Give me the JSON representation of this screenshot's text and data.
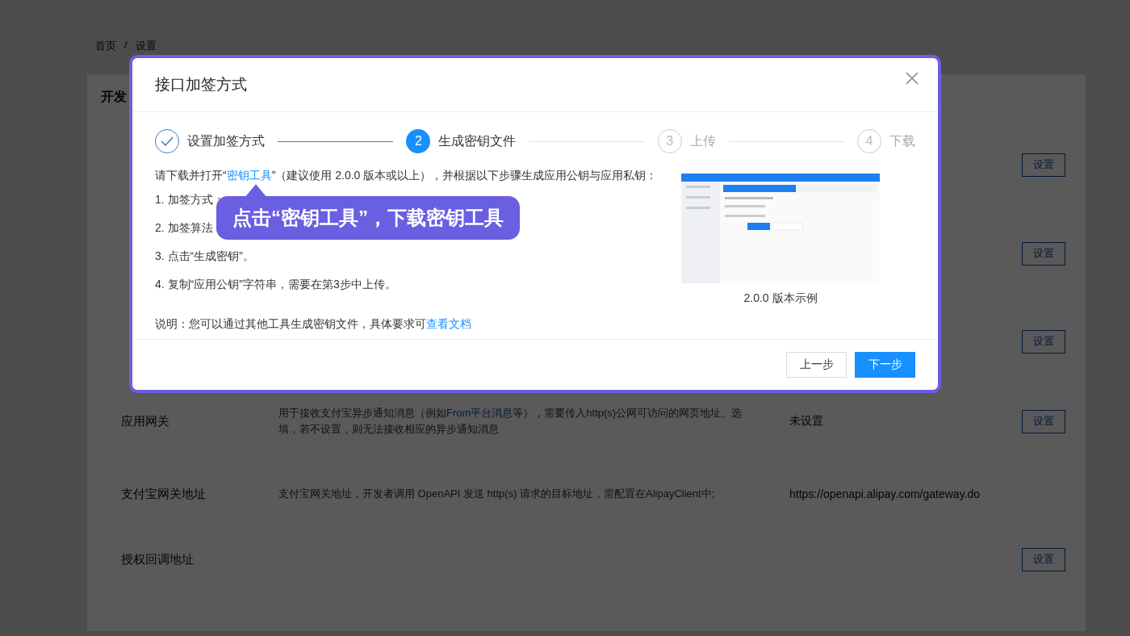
{
  "breadcrumb": {
    "items": [
      {
        "label": "首页"
      },
      {
        "label": "设置"
      }
    ],
    "separator": "/"
  },
  "section_title": "开发",
  "settings": [
    {
      "button": "设置"
    },
    {
      "button": "设置"
    },
    {
      "button": "设置"
    },
    {
      "label": "应用网关",
      "description": {
        "before": "用于接收支付宝异步通知消息（例如",
        "link": "From平台消息",
        "after": "等），需要传入http(s)公网可访问的网页地址。选填，若不设置，则无法接收相应的异步通知消息"
      },
      "value": "未设置",
      "button": "设置"
    },
    {
      "label": "支付宝网关地址",
      "description": {
        "before": "支付宝网关地址，开发者调用 OpenAPI 发送 http(s) 请求的目标地址，需配置在AlipayClient中;"
      },
      "value": "https://openapi.alipay.com/gateway.do"
    },
    {
      "label": "授权回调地址",
      "button": "设置"
    }
  ],
  "dialog": {
    "title": "接口加签方式",
    "steps": [
      {
        "label": "设置加签方式",
        "kind": "done"
      },
      {
        "number": "2",
        "label": "生成密钥文件",
        "kind": "current"
      },
      {
        "number": "3",
        "label": "上传",
        "kind": "pending"
      },
      {
        "number": "4",
        "label": "下载",
        "kind": "pending"
      }
    ],
    "intro": {
      "before": "请下载并打开“",
      "link": "密钥工具",
      "after": "”（建议使用 2.0.0 版本或以上），并根据以下步骤生成应用公钥与应用私钥："
    },
    "instructions": [
      "1. 加签方式：",
      "2. 加签算法",
      "3. 点击“生成密钥”。",
      "4. 复制“应用公钥”字符串，需要在第3步中上传。"
    ],
    "note": {
      "text": "说明：您可以通过其他工具生成密钥文件，具体要求可",
      "link": "查看文档"
    },
    "preview": {
      "kind": "picture",
      "caption": "2.0.0 版本示例"
    },
    "tooltip": "点击“密钥工具”，下载密钥工具",
    "buttons": [
      {
        "label": "上一步",
        "kind": "default"
      },
      {
        "label": "下一步",
        "kind": "primary"
      }
    ]
  }
}
